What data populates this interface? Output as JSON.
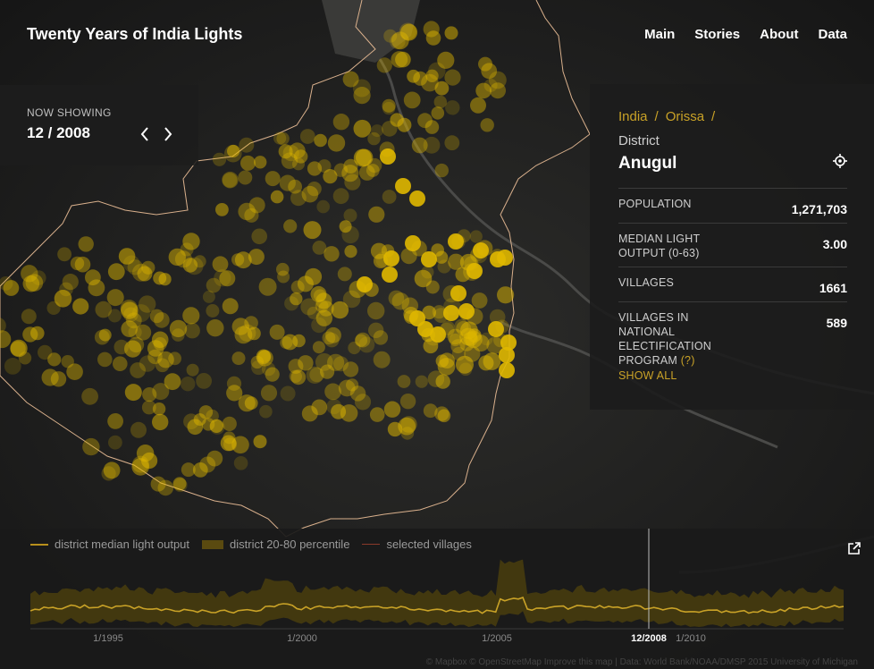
{
  "site": {
    "title": "Twenty Years of India Lights"
  },
  "nav": {
    "items": [
      "Main",
      "Stories",
      "About",
      "Data"
    ]
  },
  "now_showing": {
    "label": "NOW SHOWING",
    "date": "12 / 2008",
    "prev_icon": "chevron-left-icon",
    "next_icon": "chevron-right-icon"
  },
  "district": {
    "breadcrumb": [
      "India",
      "Orissa"
    ],
    "type": "District",
    "name": "Anugul",
    "locate_icon": "crosshair-icon"
  },
  "stats": {
    "population_label": "POPULATION",
    "population_value": "1,271,703",
    "light_label": "MEDIAN LIGHT OUTPUT (0-63)",
    "light_value": "3.00",
    "villages_label": "VILLAGES",
    "villages_value": "1661",
    "elec_label": "VILLAGES IN NATIONAL ELECTIFICATION PROGRAM",
    "elec_q": "(?)",
    "elec_value": "589",
    "show_all": "SHOW ALL"
  },
  "legend": {
    "median": "district median light output",
    "band": "district 20-80 percentile",
    "villages": "selected villages"
  },
  "timeline": {
    "ticks": [
      "1/1995",
      "1/2000",
      "1/2005",
      "1/2010"
    ],
    "current": "12/2008",
    "expand_icon": "external-link-icon"
  },
  "colors": {
    "accent": "#c9a227",
    "dot": "#e0b800",
    "border": "#d9b08c"
  },
  "attribution": "© Mapbox © OpenStreetMap Improve this map | Data: World Bank/NOAA/DMSP 2015 University of Michigan"
}
